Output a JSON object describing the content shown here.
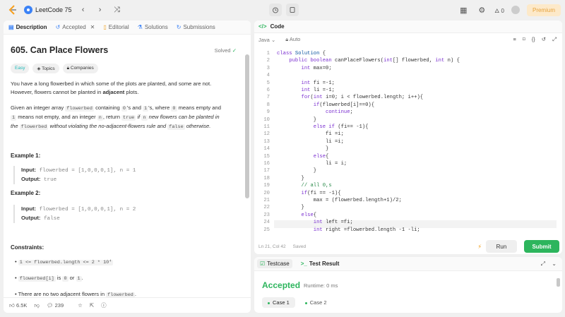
{
  "topbar": {
    "title": "LeetCode 75",
    "coins": "0",
    "premium": "Premium"
  },
  "left_tabs": [
    {
      "label": "Description",
      "icon": "description-icon"
    },
    {
      "label": "Accepted",
      "icon": "history-icon"
    },
    {
      "label": "Editorial",
      "icon": "book-icon"
    },
    {
      "label": "Solutions",
      "icon": "flask-icon"
    },
    {
      "label": "Submissions",
      "icon": "clock-icon"
    }
  ],
  "problem": {
    "title": "605. Can Place Flowers",
    "status": "Solved",
    "difficulty": "Easy",
    "topics": "Topics",
    "companies": "Companies",
    "para1_a": "You have a long flowerbed in which some of the plots are planted, and some are not.",
    "para1_b": "However, flowers cannot be planted in ",
    "para1_bold": "adjacent",
    "para1_c": " plots.",
    "para2": {
      "t1": "Given an integer array ",
      "c1": "flowerbed",
      "t2": " containing ",
      "c2": "0",
      "t3": "'s and ",
      "c3": "1",
      "t4": "'s, where ",
      "c4": "0",
      "t5": " means empty and",
      "c5": "1",
      "t6": " means not empty, and an integer ",
      "c6": "n",
      "t7": ", return ",
      "c7": "true",
      "t8": " if ",
      "c8": "n",
      "t9": " new flowers can be planted in",
      "t10": "the ",
      "c10": "flowerbed",
      "t11": " without violating the no-adjacent-flowers rule and ",
      "c11": "false",
      "t12": " otherwise."
    },
    "example1": {
      "title": "Example 1:",
      "input_label": "Input:",
      "input": "flowerbed = [1,0,0,0,1], n = 1",
      "output_label": "Output:",
      "output": "true"
    },
    "example2": {
      "title": "Example 2:",
      "input_label": "Input:",
      "input": "flowerbed = [1,0,0,0,1], n = 2",
      "output_label": "Output:",
      "output": "false"
    },
    "constraints_title": "Constraints:",
    "constraint1": "1 <= flowerbed.length <= 2 * 10⁴",
    "constraint2_code": "flowerbed[i]",
    "constraint2_t1": " is ",
    "constraint2_c2": "0",
    "constraint2_t2": " or ",
    "constraint2_c3": "1",
    "constraint2_t3": ".",
    "constraint3_t": "There are no two adjacent flowers in ",
    "constraint3_c": "flowerbed",
    "constraint3_end": "."
  },
  "footer": {
    "likes": "6.5K",
    "comments": "239"
  },
  "code": {
    "tab": "Code",
    "language": "Java",
    "mode": "Auto",
    "status": "Ln 21, Col 42",
    "saved": "Saved",
    "run": "Run",
    "submit": "Submit"
  },
  "test": {
    "tab1": "Testcase",
    "tab2": "Test Result",
    "verdict": "Accepted",
    "runtime": "Runtime: 0 ms",
    "case1": "Case 1",
    "case2": "Case 2"
  }
}
